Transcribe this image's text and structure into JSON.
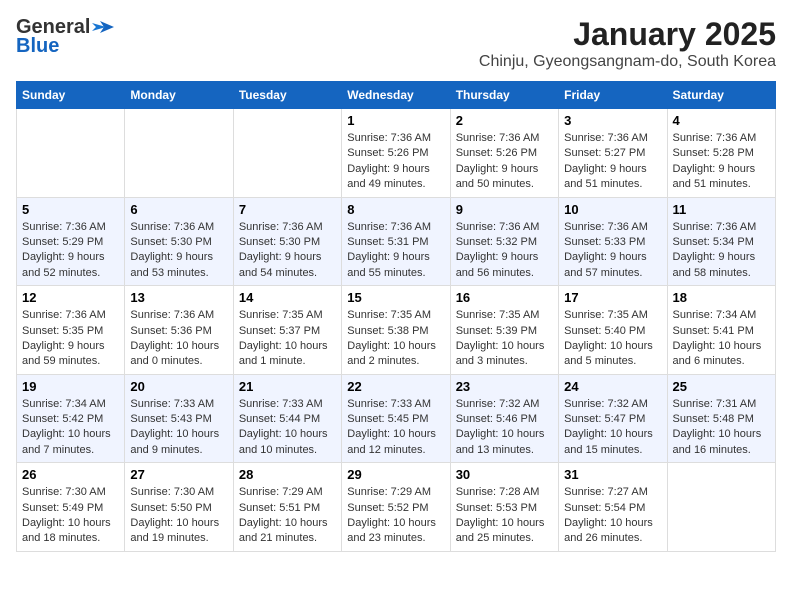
{
  "logo": {
    "general": "General",
    "blue": "Blue"
  },
  "title": "January 2025",
  "subtitle": "Chinju, Gyeongsangnam-do, South Korea",
  "days_header": [
    "Sunday",
    "Monday",
    "Tuesday",
    "Wednesday",
    "Thursday",
    "Friday",
    "Saturday"
  ],
  "weeks": [
    [
      {
        "day": "",
        "content": ""
      },
      {
        "day": "",
        "content": ""
      },
      {
        "day": "",
        "content": ""
      },
      {
        "day": "1",
        "content": "Sunrise: 7:36 AM\nSunset: 5:26 PM\nDaylight: 9 hours\nand 49 minutes."
      },
      {
        "day": "2",
        "content": "Sunrise: 7:36 AM\nSunset: 5:26 PM\nDaylight: 9 hours\nand 50 minutes."
      },
      {
        "day": "3",
        "content": "Sunrise: 7:36 AM\nSunset: 5:27 PM\nDaylight: 9 hours\nand 51 minutes."
      },
      {
        "day": "4",
        "content": "Sunrise: 7:36 AM\nSunset: 5:28 PM\nDaylight: 9 hours\nand 51 minutes."
      }
    ],
    [
      {
        "day": "5",
        "content": "Sunrise: 7:36 AM\nSunset: 5:29 PM\nDaylight: 9 hours\nand 52 minutes."
      },
      {
        "day": "6",
        "content": "Sunrise: 7:36 AM\nSunset: 5:30 PM\nDaylight: 9 hours\nand 53 minutes."
      },
      {
        "day": "7",
        "content": "Sunrise: 7:36 AM\nSunset: 5:30 PM\nDaylight: 9 hours\nand 54 minutes."
      },
      {
        "day": "8",
        "content": "Sunrise: 7:36 AM\nSunset: 5:31 PM\nDaylight: 9 hours\nand 55 minutes."
      },
      {
        "day": "9",
        "content": "Sunrise: 7:36 AM\nSunset: 5:32 PM\nDaylight: 9 hours\nand 56 minutes."
      },
      {
        "day": "10",
        "content": "Sunrise: 7:36 AM\nSunset: 5:33 PM\nDaylight: 9 hours\nand 57 minutes."
      },
      {
        "day": "11",
        "content": "Sunrise: 7:36 AM\nSunset: 5:34 PM\nDaylight: 9 hours\nand 58 minutes."
      }
    ],
    [
      {
        "day": "12",
        "content": "Sunrise: 7:36 AM\nSunset: 5:35 PM\nDaylight: 9 hours\nand 59 minutes."
      },
      {
        "day": "13",
        "content": "Sunrise: 7:36 AM\nSunset: 5:36 PM\nDaylight: 10 hours\nand 0 minutes."
      },
      {
        "day": "14",
        "content": "Sunrise: 7:35 AM\nSunset: 5:37 PM\nDaylight: 10 hours\nand 1 minute."
      },
      {
        "day": "15",
        "content": "Sunrise: 7:35 AM\nSunset: 5:38 PM\nDaylight: 10 hours\nand 2 minutes."
      },
      {
        "day": "16",
        "content": "Sunrise: 7:35 AM\nSunset: 5:39 PM\nDaylight: 10 hours\nand 3 minutes."
      },
      {
        "day": "17",
        "content": "Sunrise: 7:35 AM\nSunset: 5:40 PM\nDaylight: 10 hours\nand 5 minutes."
      },
      {
        "day": "18",
        "content": "Sunrise: 7:34 AM\nSunset: 5:41 PM\nDaylight: 10 hours\nand 6 minutes."
      }
    ],
    [
      {
        "day": "19",
        "content": "Sunrise: 7:34 AM\nSunset: 5:42 PM\nDaylight: 10 hours\nand 7 minutes."
      },
      {
        "day": "20",
        "content": "Sunrise: 7:33 AM\nSunset: 5:43 PM\nDaylight: 10 hours\nand 9 minutes."
      },
      {
        "day": "21",
        "content": "Sunrise: 7:33 AM\nSunset: 5:44 PM\nDaylight: 10 hours\nand 10 minutes."
      },
      {
        "day": "22",
        "content": "Sunrise: 7:33 AM\nSunset: 5:45 PM\nDaylight: 10 hours\nand 12 minutes."
      },
      {
        "day": "23",
        "content": "Sunrise: 7:32 AM\nSunset: 5:46 PM\nDaylight: 10 hours\nand 13 minutes."
      },
      {
        "day": "24",
        "content": "Sunrise: 7:32 AM\nSunset: 5:47 PM\nDaylight: 10 hours\nand 15 minutes."
      },
      {
        "day": "25",
        "content": "Sunrise: 7:31 AM\nSunset: 5:48 PM\nDaylight: 10 hours\nand 16 minutes."
      }
    ],
    [
      {
        "day": "26",
        "content": "Sunrise: 7:30 AM\nSunset: 5:49 PM\nDaylight: 10 hours\nand 18 minutes."
      },
      {
        "day": "27",
        "content": "Sunrise: 7:30 AM\nSunset: 5:50 PM\nDaylight: 10 hours\nand 19 minutes."
      },
      {
        "day": "28",
        "content": "Sunrise: 7:29 AM\nSunset: 5:51 PM\nDaylight: 10 hours\nand 21 minutes."
      },
      {
        "day": "29",
        "content": "Sunrise: 7:29 AM\nSunset: 5:52 PM\nDaylight: 10 hours\nand 23 minutes."
      },
      {
        "day": "30",
        "content": "Sunrise: 7:28 AM\nSunset: 5:53 PM\nDaylight: 10 hours\nand 25 minutes."
      },
      {
        "day": "31",
        "content": "Sunrise: 7:27 AM\nSunset: 5:54 PM\nDaylight: 10 hours\nand 26 minutes."
      },
      {
        "day": "",
        "content": ""
      }
    ]
  ]
}
